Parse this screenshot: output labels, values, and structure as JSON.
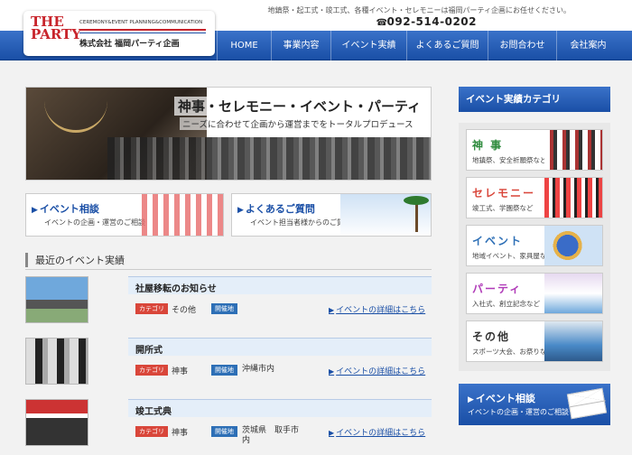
{
  "header": {
    "tagline": "地鎮祭・起工式・竣工式、各種イベント・セレモニーは福岡パーティ企画にお任せください。",
    "phone": "092-514-0202",
    "logo": {
      "main": "THE PARTY",
      "sub": "CEREMONY&EVENT PLANNING&COMMUNICATION",
      "company": "株式会社 福岡パーティ企画"
    }
  },
  "nav": {
    "items": [
      {
        "label": "HOME"
      },
      {
        "label": "事業内容"
      },
      {
        "label": "イベント実績"
      },
      {
        "label": "よくあるご質問"
      },
      {
        "label": "お問合わせ"
      },
      {
        "label": "会社案内"
      }
    ]
  },
  "hero": {
    "title": "神事・セレモニー・イベント・パーティ",
    "subtitle": "ニーズに合わせて企画から運営までをトータルプロデュース"
  },
  "banners": [
    {
      "title": "イベント相談",
      "sub": "イベントの企画・運営のご相談"
    },
    {
      "title": "よくあるご質問",
      "sub": "イベント担当者様からのご質問"
    }
  ],
  "recent": {
    "title": "最近のイベント実績",
    "category_tag": "カテゴリ",
    "place_tag": "開催地",
    "detail_link": "イベントの詳細はこちら",
    "events": [
      {
        "title": "社屋移転のお知らせ",
        "category": "その他",
        "place": ""
      },
      {
        "title": "開所式",
        "category": "神事",
        "place": "沖縄市内"
      },
      {
        "title": "竣工式典",
        "category": "神事",
        "place": "茨城県　取手市内"
      }
    ]
  },
  "sidebar": {
    "title": "イベント実績カテゴリ",
    "categories": [
      {
        "name": "神 事",
        "desc": "地鎮祭、安全祈願祭など",
        "color": "#2e8b3d"
      },
      {
        "name": "セレモニー",
        "desc": "竣工式、学園祭など",
        "color": "#d9463a"
      },
      {
        "name": "イベント",
        "desc": "地域イベント、家具屋など",
        "color": "#2d6fb6"
      },
      {
        "name": "パーティ",
        "desc": "入社式、創立記念など",
        "color": "#b03ab8"
      },
      {
        "name": "その他",
        "desc": "スポーツ大会、お祭りなど",
        "color": "#333333"
      }
    ],
    "consult": {
      "title": "イベント相談",
      "sub": "イベントの企画・運営のご相談"
    }
  },
  "colors": {
    "brand_blue": "#1a4fa6",
    "brand_red": "#c8242b"
  }
}
